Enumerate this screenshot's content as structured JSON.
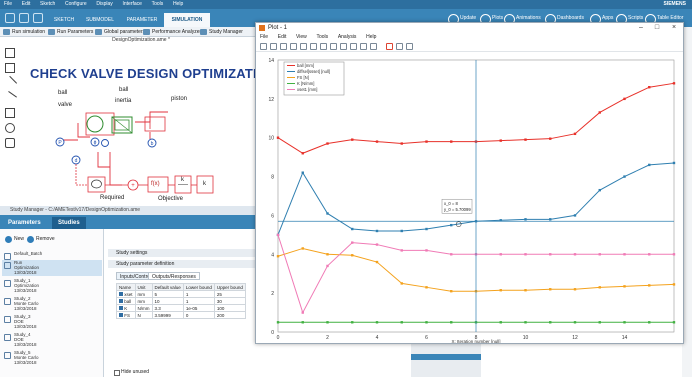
{
  "app": {
    "menu": [
      "File",
      "Edit",
      "Sketch",
      "Configure",
      "Display",
      "Interface",
      "Tools",
      "Help"
    ],
    "ribbon_tabs": [
      "SKETCH",
      "SUBMODEL",
      "PARAMETER",
      "SIMULATION"
    ],
    "active_tab": "SIMULATION",
    "ribbon_right": [
      "Update",
      "Plots",
      "Animations",
      "Dashboards",
      "Apps",
      "Scripts",
      "Table Editor"
    ],
    "brand": "SIEMENS",
    "toolbar": [
      "Run simulation",
      "Run Parameters",
      "Global parameters",
      "Performance Analyzer",
      "Study Manager"
    ]
  },
  "diagram": {
    "file_title": "DesignOptimization.ame *",
    "heading": "CHECK VALVE DESIGN OPTIMIZATION",
    "labels": {
      "ball_valve_1": "ball",
      "ball_valve_2": "valve",
      "ball_inertia_1": "ball",
      "ball_inertia_2": "inertia",
      "piston": "piston",
      "required": "Required",
      "objective": "Objective"
    },
    "blocks": {
      "fx": "f(x)",
      "k1": "k",
      "k2": "k"
    }
  },
  "study_manager": {
    "title": "Study Manager - C:/AMETest/v17/DesignOptimization.ame",
    "tabs": [
      "Parameters",
      "Studies"
    ],
    "new_label": "New",
    "remove_label": "Remove",
    "studies": [
      {
        "name": "Default_Batch",
        "type": "",
        "date": ""
      },
      {
        "name": "Run",
        "type": "Optimization",
        "date": "13/03/2018"
      },
      {
        "name": "Study_1",
        "type": "Optimization",
        "date": "13/03/2018"
      },
      {
        "name": "Study_2",
        "type": "Monte Carlo",
        "date": "13/03/2018"
      },
      {
        "name": "Study_3",
        "type": "DOE",
        "date": "13/03/2018"
      },
      {
        "name": "Study_4",
        "type": "DOE",
        "date": "13/03/2018"
      },
      {
        "name": "Study_5",
        "type": "Monte Carlo",
        "date": "13/03/2018"
      }
    ],
    "sections": [
      "Study settings",
      "Study parameter definition"
    ],
    "inner_tabs": [
      "Inputs/Controls",
      "Outputs/Responses"
    ],
    "table": {
      "headers": [
        "Name",
        "Unit",
        "Default value",
        "Lower bound",
        "Upper bound"
      ],
      "rows": [
        [
          "xset",
          "mm",
          "5",
          "1",
          "25"
        ],
        [
          "ball",
          "mm",
          "10",
          "1",
          "30"
        ],
        [
          "K",
          "N/mm",
          "3.3",
          "1e-05",
          "100"
        ],
        [
          "FS",
          "N",
          "3.59999",
          "0",
          "200"
        ]
      ]
    },
    "hide_unused": "Hide unused"
  },
  "plot_window": {
    "title": "Plot - 1",
    "menu": [
      "File",
      "Edit",
      "View",
      "Tools",
      "Analysis",
      "Help"
    ],
    "cursor_readout": [
      "x_0 = 8",
      "y_0 = 5.70099"
    ]
  },
  "chart_data": {
    "type": "line",
    "title": "",
    "xlabel": "X: Iteration number [null]",
    "ylabel": "",
    "xlim": [
      0,
      16
    ],
    "ylim": [
      0,
      14
    ],
    "xticks": [
      0,
      2,
      4,
      6,
      8,
      10,
      12,
      14
    ],
    "yticks": [
      0,
      2,
      4,
      6,
      8,
      10,
      12,
      14
    ],
    "grid": true,
    "legend_position": "top-left",
    "cursor": {
      "x": 8,
      "y": 5.70099
    },
    "x": [
      0,
      1,
      2,
      3,
      4,
      5,
      6,
      7,
      8,
      9,
      10,
      11,
      12,
      13,
      14,
      15,
      16
    ],
    "series": [
      {
        "name": "ball [mm]",
        "color": "#e8312a",
        "values": [
          10.0,
          9.2,
          9.7,
          9.9,
          9.8,
          9.7,
          9.8,
          9.8,
          9.8,
          9.85,
          9.9,
          9.95,
          10.2,
          11.3,
          12.0,
          12.6,
          12.8
        ]
      },
      {
        "name": "diffsel[ssset] [null]",
        "color": "#2f7fb0",
        "values": [
          5.0,
          8.2,
          6.1,
          5.3,
          5.2,
          5.2,
          5.3,
          5.5,
          5.7,
          5.75,
          5.8,
          5.8,
          6.0,
          7.3,
          8.0,
          8.6,
          8.7
        ]
      },
      {
        "name": "FS [N]",
        "color": "#f4a21d",
        "values": [
          3.9,
          4.3,
          4.0,
          3.95,
          3.6,
          2.5,
          2.3,
          2.1,
          2.1,
          2.15,
          2.15,
          2.2,
          2.2,
          2.3,
          2.35,
          2.4,
          2.45
        ]
      },
      {
        "name": "K [N/mm]",
        "color": "#41b141",
        "values": [
          0.5,
          0.5,
          0.5,
          0.5,
          0.5,
          0.5,
          0.5,
          0.5,
          0.5,
          0.5,
          0.5,
          0.5,
          0.5,
          0.5,
          0.5,
          0.5,
          0.5
        ]
      },
      {
        "name": "xset1 [mm]",
        "color": "#f07bb6",
        "values": [
          5.0,
          1.0,
          3.4,
          4.6,
          4.5,
          4.2,
          4.2,
          4.0,
          4.0,
          4.0,
          4.0,
          4.0,
          4.0,
          4.0,
          4.0,
          4.0,
          4.0
        ]
      }
    ]
  }
}
